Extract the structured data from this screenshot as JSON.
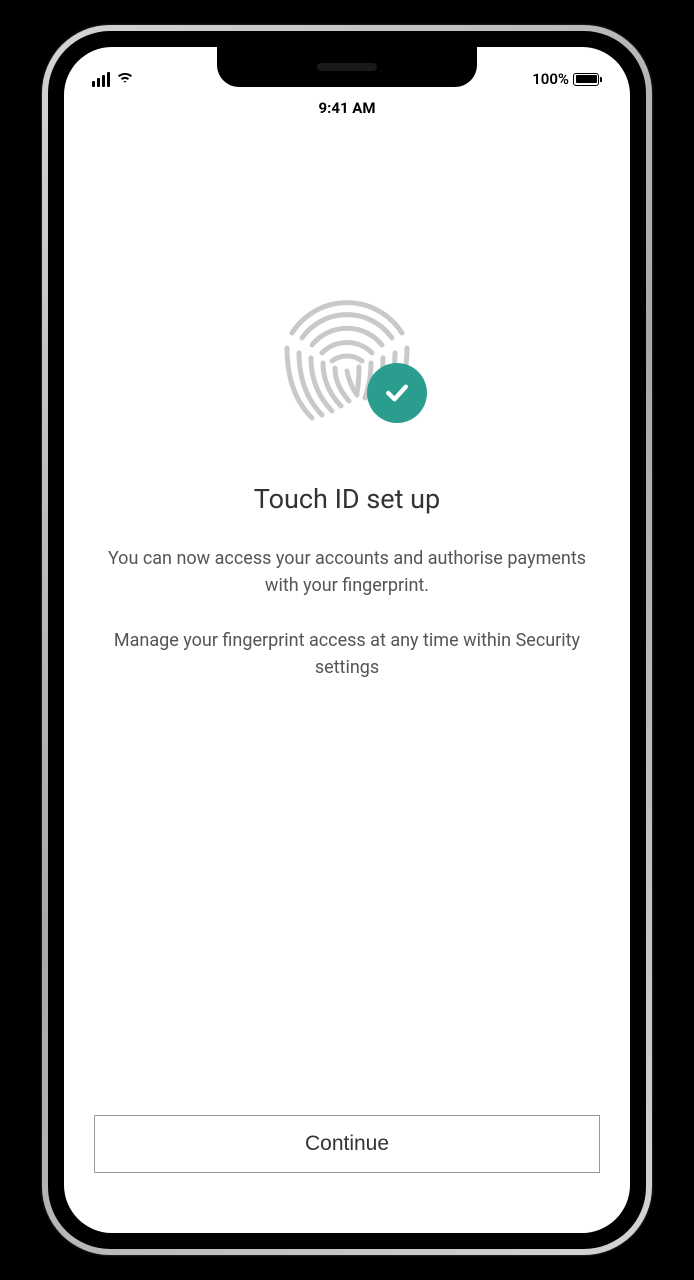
{
  "status_bar": {
    "time": "9:41 AM",
    "battery_pct": "100%"
  },
  "main": {
    "title": "Touch ID set  up",
    "description": "You can now access your accounts and authorise payments with your fingerprint.",
    "note": "Manage your fingerprint access at any time within Security settings"
  },
  "actions": {
    "continue_label": "Continue"
  },
  "colors": {
    "accent": "#2b9d8f"
  }
}
